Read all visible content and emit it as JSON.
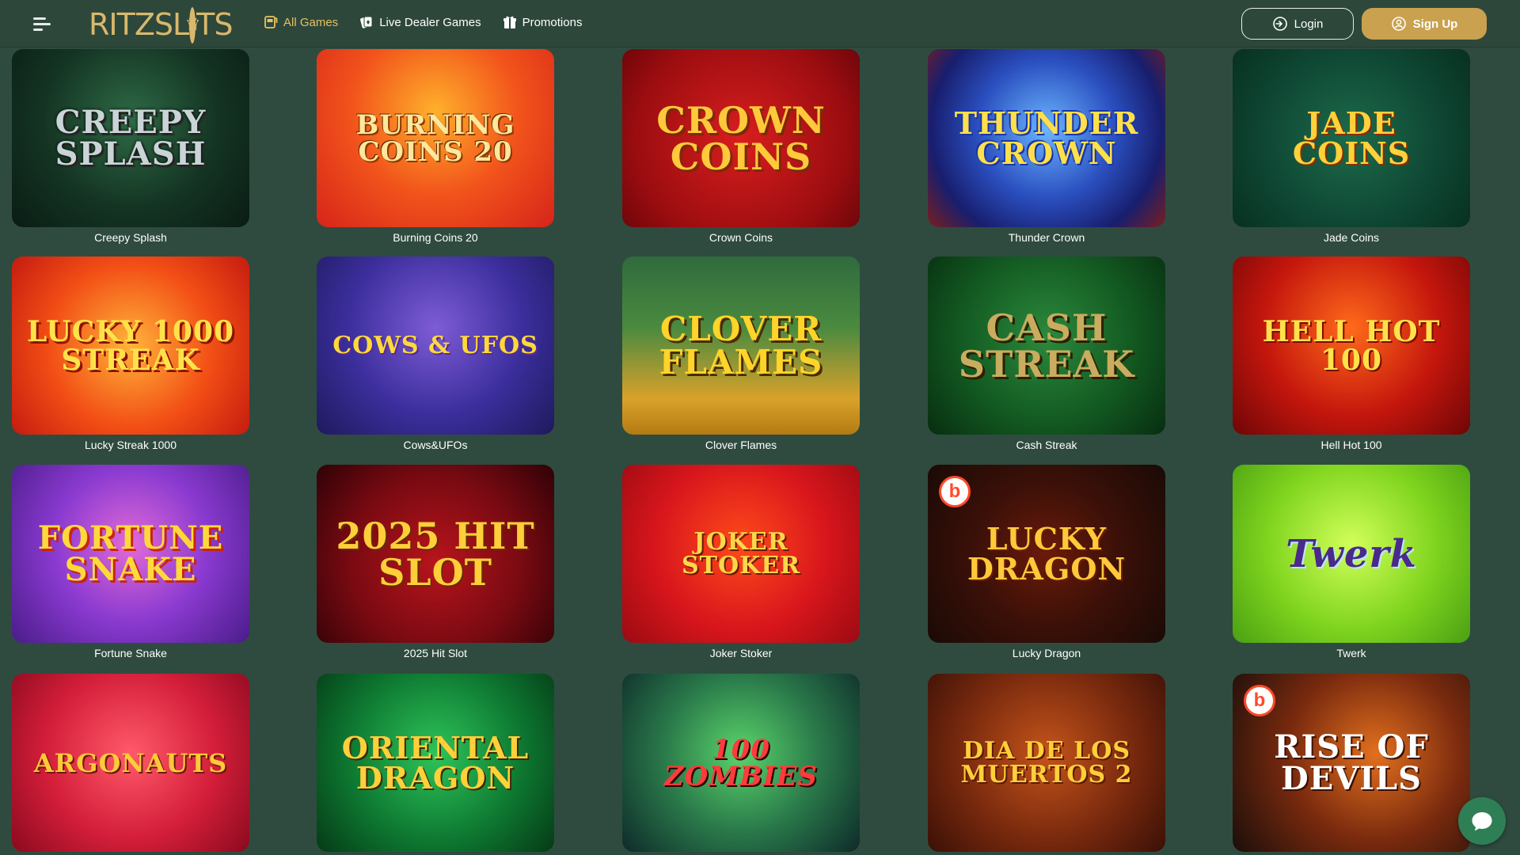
{
  "header": {
    "logo_text": "RITZSLOTS",
    "nav": [
      {
        "label": "All Games",
        "icon": "slot-machine-icon",
        "active": true
      },
      {
        "label": "Live Dealer Games",
        "icon": "cards-icon",
        "active": false
      },
      {
        "label": "Promotions",
        "icon": "gift-icon",
        "active": false
      }
    ],
    "login_label": "Login",
    "signup_label": "Sign Up"
  },
  "colors": {
    "background": "#2f4b3f",
    "accent_gold": "#c9a14f",
    "active_nav": "#e8c15f"
  },
  "games": [
    {
      "title": "Creepy Splash",
      "art_text": "Creepy Splash"
    },
    {
      "title": "Burning Coins 20",
      "art_text": "Burning Coins 20"
    },
    {
      "title": "Crown Coins",
      "art_text": "Crown Coins"
    },
    {
      "title": "Thunder Crown",
      "art_text": "Thunder Crown"
    },
    {
      "title": "Jade Coins",
      "art_text": "Jade Coins"
    },
    {
      "title": "Lucky Streak 1000",
      "art_text": "Lucky 1000 Streak"
    },
    {
      "title": "Cows&UFOs",
      "art_text": "Cows & UFOs"
    },
    {
      "title": "Clover Flames",
      "art_text": "Clover Flames"
    },
    {
      "title": "Cash Streak",
      "art_text": "Cash Streak"
    },
    {
      "title": "Hell Hot 100",
      "art_text": "Hell Hot 100"
    },
    {
      "title": "Fortune Snake",
      "art_text": "Fortune Snake"
    },
    {
      "title": "2025 Hit Slot",
      "art_text": "2025 Hit Slot"
    },
    {
      "title": "Joker Stoker",
      "art_text": "Joker Stoker"
    },
    {
      "title": "Lucky Dragon",
      "art_text": "Lucky Dragon",
      "badge": "b"
    },
    {
      "title": "Twerk",
      "art_text": "Twerk"
    },
    {
      "title": "",
      "art_text": "Argonauts"
    },
    {
      "title": "",
      "art_text": "Oriental Dragon"
    },
    {
      "title": "",
      "art_text": "100 Zombies"
    },
    {
      "title": "",
      "art_text": "Dia de los Muertos 2"
    },
    {
      "title": "",
      "art_text": "Rise of Devils",
      "badge": "b"
    }
  ]
}
